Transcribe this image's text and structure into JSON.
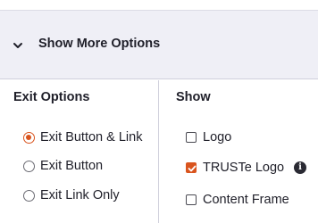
{
  "more_options": {
    "label": "Show More Options",
    "icon": "chevron-down-icon"
  },
  "exit_options": {
    "title": "Exit Options",
    "selected": "Exit Button & Link",
    "items": [
      {
        "label": "Exit Button & Link",
        "checked": true
      },
      {
        "label": "Exit Button",
        "checked": false
      },
      {
        "label": "Exit Link Only",
        "checked": false
      }
    ]
  },
  "show": {
    "title": "Show",
    "items": [
      {
        "label": "Logo",
        "checked": false
      },
      {
        "label": "TRUSTe Logo",
        "checked": true,
        "info_icon": "info-icon"
      },
      {
        "label": "Content Frame",
        "checked": false
      }
    ]
  },
  "colors": {
    "accent": "#d9541e",
    "header_bg": "#efeff6",
    "text": "#1f1f29"
  }
}
